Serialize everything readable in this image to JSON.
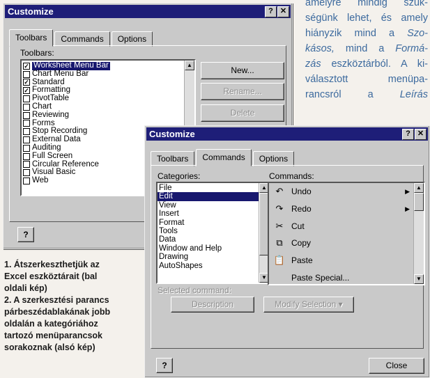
{
  "article": {
    "lines": [
      "amelyre mindig szük-",
      "ségünk lehet, és amely",
      [
        "hiányzik mind a ",
        "Szo-"
      ],
      [
        "kásos,",
        " mind a ",
        "Formá-"
      ],
      [
        "zás",
        " eszköztárból. A ki-"
      ],
      "választott menüpa-",
      [
        "rancsról a ",
        "Leírás"
      ]
    ]
  },
  "caption": {
    "lines": [
      "1. Átszerkeszthetjük az",
      "Excel eszköztárait (bal",
      "oldali kép)",
      "2. A szerkesztési parancs",
      "párbeszédablakának jobb",
      "oldalán a kategóriához",
      "tartozó menüparancsok",
      "sorakoznak (alsó kép)"
    ]
  },
  "dialog1": {
    "title": "Customize",
    "help_glyph": "?",
    "close_glyph": "✕",
    "tabs": [
      {
        "label": "Toolbars",
        "active": true
      },
      {
        "label": "Commands",
        "active": false
      },
      {
        "label": "Options",
        "active": false
      }
    ],
    "toolbars_label": "Toolbars:",
    "toolbars": [
      {
        "label": "Worksheet Menu Bar",
        "checked": true,
        "selected": true
      },
      {
        "label": "Chart Menu Bar",
        "checked": false,
        "selected": false
      },
      {
        "label": "Standard",
        "checked": true,
        "selected": false
      },
      {
        "label": "Formatting",
        "checked": true,
        "selected": false
      },
      {
        "label": "PivotTable",
        "checked": false,
        "selected": false
      },
      {
        "label": "Chart",
        "checked": false,
        "selected": false
      },
      {
        "label": "Reviewing",
        "checked": false,
        "selected": false
      },
      {
        "label": "Forms",
        "checked": false,
        "selected": false
      },
      {
        "label": "Stop Recording",
        "checked": false,
        "selected": false
      },
      {
        "label": "External Data",
        "checked": false,
        "selected": false
      },
      {
        "label": "Auditing",
        "checked": false,
        "selected": false
      },
      {
        "label": "Full Screen",
        "checked": false,
        "selected": false
      },
      {
        "label": "Circular Reference",
        "checked": false,
        "selected": false
      },
      {
        "label": "Visual Basic",
        "checked": false,
        "selected": false
      },
      {
        "label": "Web",
        "checked": false,
        "selected": false
      }
    ],
    "new_label": "New...",
    "rename_label": "Rename...",
    "delete_label": "Delete",
    "help_button": "?"
  },
  "dialog2": {
    "title": "Customize",
    "help_glyph": "?",
    "close_glyph": "✕",
    "tabs": [
      {
        "label": "Toolbars",
        "active": false
      },
      {
        "label": "Commands",
        "active": true
      },
      {
        "label": "Options",
        "active": false
      }
    ],
    "categories_label": "Categories:",
    "categories": [
      "File",
      "Edit",
      "View",
      "Insert",
      "Format",
      "Tools",
      "Data",
      "Window and Help",
      "Drawing",
      "AutoShapes"
    ],
    "selected_category": "Edit",
    "commands_label": "Commands:",
    "commands": [
      {
        "icon": "undo-icon",
        "glyph": "↶",
        "label": "Undo",
        "submenu": true
      },
      {
        "icon": "redo-icon",
        "glyph": "↷",
        "label": "Redo",
        "submenu": true
      },
      {
        "icon": "cut-icon",
        "glyph": "✂",
        "label": "Cut",
        "submenu": false
      },
      {
        "icon": "copy-icon",
        "glyph": "⧉",
        "label": "Copy",
        "submenu": false
      },
      {
        "icon": "paste-icon",
        "glyph": "📋",
        "label": "Paste",
        "submenu": false
      },
      {
        "icon": "",
        "glyph": "",
        "label": "Paste Special...",
        "submenu": false
      }
    ],
    "selected_command_label": "Selected command:",
    "description_label": "Description",
    "modify_selection_label": "Modify Selection ▾",
    "help_button": "?",
    "close_label": "Close"
  },
  "colors": {
    "titlebar": "#1e1e78",
    "dialog_face": "#c9c9c9",
    "selection": "#17176e",
    "article_text": "#3c6a9e"
  }
}
